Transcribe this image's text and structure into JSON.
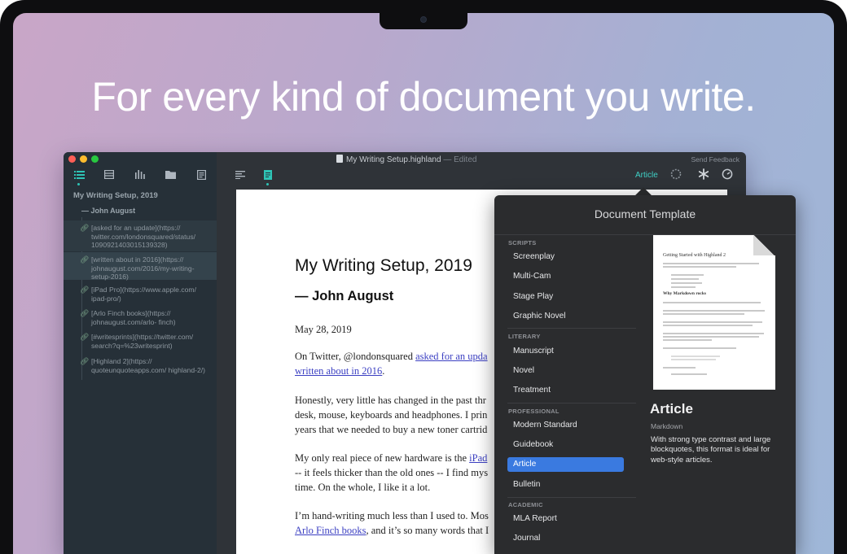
{
  "headline": "For every kind of document you write.",
  "window": {
    "file_name": "My Writing Setup.highland",
    "edited_suffix": "— Edited",
    "send_feedback": "Send Feedback"
  },
  "sidebar": {
    "outline_title": "My Writing Setup, 2019",
    "outline_subtitle": "— John August",
    "links": [
      {
        "text": "[asked for an update](https:// twitter.com/londonsquared/status/ 1090921403015139328)"
      },
      {
        "text": "[written about in 2016](https:// johnaugust.com/2016/my-writing- setup-2016)"
      },
      {
        "text": "[iPad Pro](https://www.apple.com/ ipad-pro/)"
      },
      {
        "text": "[Arlo Finch books](https:// johnaugust.com/arlo- finch)"
      },
      {
        "text": "[#writesprints](https://twitter.com/ search?q=%23writesprint)"
      },
      {
        "text": "[Highland 2](https:// quoteunquoteapps.com/ highland-2/)"
      }
    ]
  },
  "toolbar": {
    "article_label": "Article"
  },
  "document": {
    "title": "My Writing Setup, 2019",
    "author": "— John August",
    "date": "May 28, 2019",
    "p1_a": "On Twitter, @londonsquared ",
    "p1_link1": "asked for an upda",
    "p1_link2": "written about in 2016",
    "p1_b": ".",
    "p2_l1": "Honestly, very little has changed in the past thr",
    "p2_l2": "desk, mouse, keyboards and headphones. I prin",
    "p2_l3": "years that we needed to buy a new toner cartrid",
    "p3_a": "My only real piece of new hardware is the ",
    "p3_link": "iPad",
    "p3_l2": "-- it feels thicker than the old ones -- I find mys",
    "p3_l3": "time. On the whole, I like it a lot.",
    "p4_l1": "I’m hand-writing much less than I used to. Mos",
    "p4_link": "Arlo Finch books",
    "p4_l2b": ", and it’s so many words that I"
  },
  "popover": {
    "title": "Document Template",
    "sections": [
      {
        "label": "SCRIPTS",
        "items": [
          "Screenplay",
          "Multi-Cam",
          "Stage Play",
          "Graphic Novel"
        ]
      },
      {
        "label": "LITERARY",
        "items": [
          "Manuscript",
          "Novel",
          "Treatment"
        ]
      },
      {
        "label": "PROFESSIONAL",
        "items": [
          "Modern Standard",
          "Guidebook",
          "Article",
          "Bulletin"
        ]
      },
      {
        "label": "ACADEMIC",
        "items": [
          "MLA Report",
          "Journal"
        ]
      }
    ],
    "selected": "Article",
    "preview_heading": "Getting Started with Highland 2",
    "preview_sub": "Why Markdown rocks",
    "detail_title": "Article",
    "detail_format": "Markdown",
    "detail_description": "With strong type contrast and large blockquotes, this format is ideal for web-style articles."
  },
  "colors": {
    "accent": "#2ec4b6",
    "selection": "#3a7ae0",
    "link": "#3b3fc2"
  }
}
